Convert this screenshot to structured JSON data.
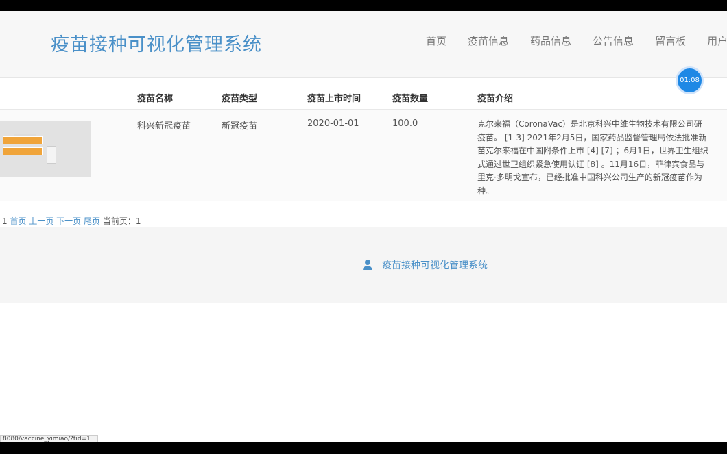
{
  "header": {
    "site_title": "疫苗接种可视化管理系统",
    "nav": [
      "首页",
      "疫苗信息",
      "药品信息",
      "公告信息",
      "留言板",
      "用户"
    ]
  },
  "timer": "01:08",
  "table": {
    "headers": [
      "疫苗名称",
      "疫苗类型",
      "疫苗上市时间",
      "疫苗数量",
      "疫苗介绍"
    ],
    "row": {
      "name": "科兴新冠疫苗",
      "type": "新冠疫苗",
      "date": "2020-01-01",
      "quantity": "100.0",
      "desc_lines": [
        "克尔来福（CoronaVac）是北京科兴中维生物技术有限公司研",
        "疫苗。 [1-3] 2021年2月5日，国家药品监督管理局依法批准新",
        "苗克尔来福在中国附条件上市 [4] [7] ；6月1日，世界卫生组织",
        "式通过世卫组织紧急使用认证 [8] 。11月16日，菲律宾食品与",
        "里克·多明戈宣布，已经批准中国科兴公司生产的新冠疫苗作为",
        "种。"
      ]
    }
  },
  "pager": {
    "count": "1",
    "first": "首页",
    "prev": "上一页",
    "next": "下一页",
    "last": "尾页",
    "current_label": "当前页：1"
  },
  "footer": {
    "brand": "疫苗接种可视化管理系统",
    "icon": "user-icon"
  },
  "status_bar_url": "8080/vaccine_yimiao/?tid=1"
}
